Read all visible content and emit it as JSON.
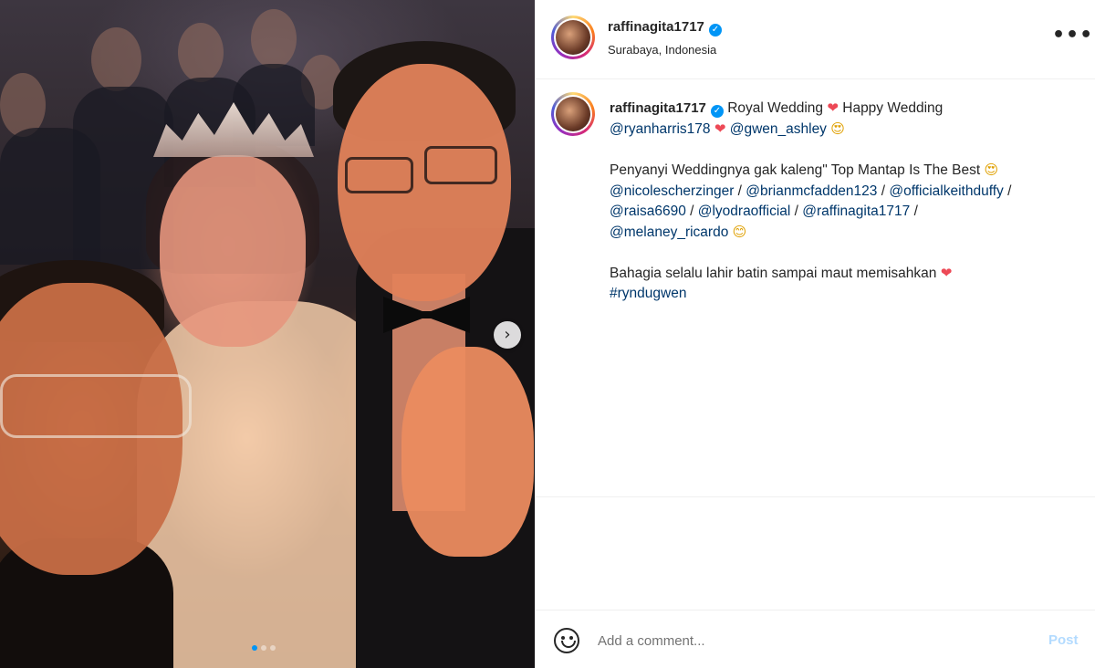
{
  "post": {
    "username": "raffinagita1717",
    "location": "Surabaya, Indonesia",
    "more_label": "•••"
  },
  "media": {
    "next_label": "›",
    "carousel_total": 3,
    "carousel_active": 1
  },
  "caption": {
    "username": "raffinagita1717",
    "line1_text": "Royal Wedding",
    "heart": "❤",
    "line1_text2": "Happy Wedding",
    "mention_ryan": "@ryanharris178",
    "mention_gwen": "@gwen_ashley",
    "heart_eyes": "😍",
    "para2_text": "Penyanyi Weddingnya gak kaleng\" Top Mantap Is The Best",
    "mention_nicole": "@nicolescherzinger",
    "mention_brian": "@brianmcfadden123",
    "mention_keith": "@officialkeithduffy",
    "mention_raisa": "@raisa6690",
    "mention_lyodra": "@lyodraofficial",
    "mention_raffi": "@raffinagita1717",
    "mention_melaney": "@melaney_ricardo",
    "separator": " / ",
    "smile": "😊",
    "para3_text": "Bahagia selalu lahir batin sampai maut memisahkan",
    "hashtag": "#ryndugwen"
  },
  "comment": {
    "placeholder": "Add a comment...",
    "post_label": "Post"
  },
  "colors": {
    "link": "#00376b",
    "heart": "#ed4956",
    "verified": "#0095f6",
    "post_disabled": "#b3dbff"
  }
}
